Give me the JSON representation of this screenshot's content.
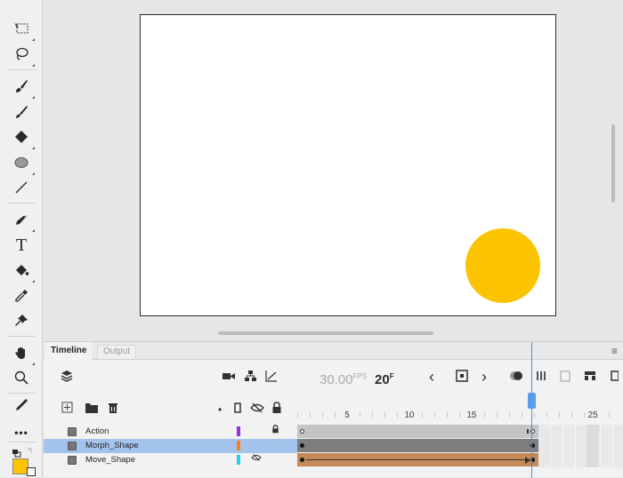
{
  "toolbar": {
    "tools": [
      {
        "name": "free-transform-tool",
        "glyph": "⧉"
      },
      {
        "name": "lasso-tool",
        "glyph": "ᑭ"
      },
      {
        "name": "brush-tool",
        "glyph": "🖌"
      },
      {
        "name": "paint-brush-tool",
        "glyph": "✎"
      },
      {
        "name": "eraser-tool",
        "glyph": "◆"
      },
      {
        "name": "oval-tool",
        "glyph": "⬬"
      },
      {
        "name": "line-tool",
        "glyph": "∕"
      },
      {
        "name": "pen-tool",
        "glyph": "✒"
      },
      {
        "name": "text-tool",
        "glyph": "T"
      },
      {
        "name": "paint-bucket-tool",
        "glyph": "⛽"
      },
      {
        "name": "eyedropper-tool",
        "glyph": "✐"
      },
      {
        "name": "pin-tool",
        "glyph": "✦"
      },
      {
        "name": "hand-tool",
        "glyph": "✋"
      },
      {
        "name": "zoom-tool",
        "glyph": "⚲"
      },
      {
        "name": "pencil-tool",
        "glyph": "✏"
      },
      {
        "name": "more-tools",
        "glyph": "•••"
      }
    ],
    "fill_color": "#fcc400"
  },
  "stage": {
    "background": "#ffffff",
    "circle_color": "#fcc400"
  },
  "timeline": {
    "tabs": {
      "active": "Timeline",
      "inactive": "Output"
    },
    "fps_value": "30.00",
    "fps_unit": "FPS",
    "frame_value": "20",
    "frame_unit": "F",
    "ruler_labels": [
      "5",
      "10",
      "15",
      "25"
    ],
    "layers": [
      {
        "name": "Action",
        "color": "#9b30d9",
        "selected": false,
        "locked": true
      },
      {
        "name": "Morph_Shape",
        "color": "#ff7f1a",
        "selected": true,
        "locked": false
      },
      {
        "name": "Move_Shape",
        "color": "#22d3e6",
        "selected": false,
        "locked": false,
        "hidden": true
      }
    ]
  }
}
